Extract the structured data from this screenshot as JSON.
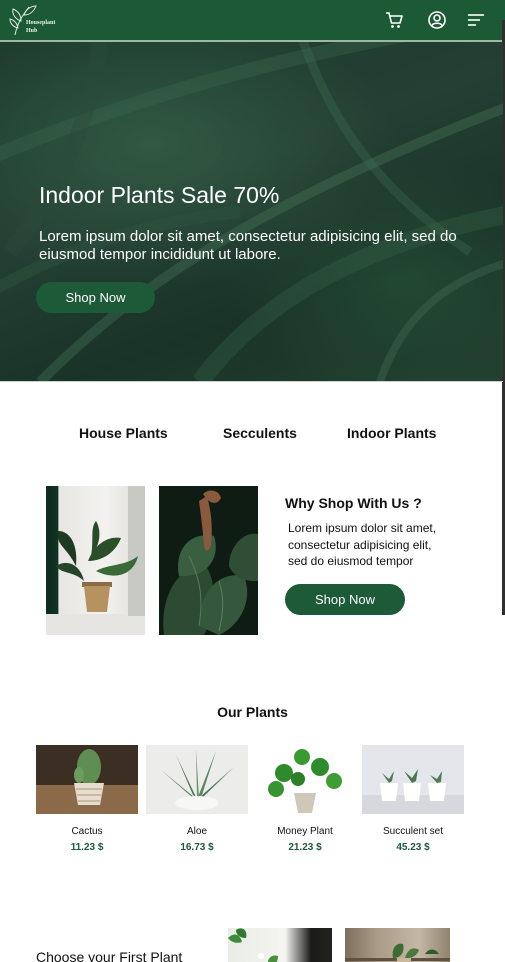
{
  "header": {
    "logo_text_line1": "Houseplant",
    "logo_text_line2": "Hub",
    "background": "#1b5a34",
    "icons": [
      "cart-icon",
      "user-icon",
      "menu-icon"
    ]
  },
  "hero": {
    "title": "Indoor Plants Sale 70%",
    "subtitle": "Lorem ipsum dolor sit amet, consectetur adipisicing elit, sed do eiusmod tempor incididunt ut labore.",
    "button_label": "Shop Now"
  },
  "categories": [
    "House Plants",
    "Secculents",
    "Indoor Plants"
  ],
  "why": {
    "title": "Why Shop With Us ?",
    "text": "Lorem ipsum dolor sit amet, consectetur adipisicing elit, sed do eiusmod tempor",
    "button_label": "Shop Now"
  },
  "plants": {
    "title": "Our Plants",
    "items": [
      {
        "name": "Cactus",
        "price": "11.23 $"
      },
      {
        "name": "Aloe",
        "price": "16.73 $"
      },
      {
        "name": "Money Plant",
        "price": "21.23 $"
      },
      {
        "name": "Succulent set",
        "price": "45.23 $"
      }
    ]
  },
  "bottom": {
    "title": "Choose your First Plant"
  },
  "colors": {
    "brand_green": "#1d5a37",
    "header_green": "#1b5a34"
  }
}
